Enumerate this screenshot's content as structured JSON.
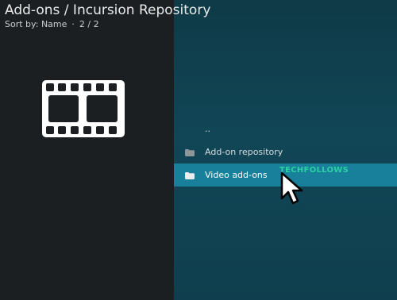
{
  "header": {
    "title": "Add-ons / Incursion Repository",
    "sort_label": "Sort by: Name",
    "separator": "·",
    "page_indicator": "2 / 2"
  },
  "thumbnail": {
    "icon": "film-strip-icon"
  },
  "list": {
    "items": [
      {
        "label": "..",
        "icon": ""
      },
      {
        "label": "Add-on repository",
        "icon": "folder-icon"
      },
      {
        "label": "Video add-ons",
        "icon": "folder-icon",
        "selected": true
      }
    ]
  },
  "watermark": "TECHFOLLOWS",
  "colors": {
    "left_pane": "#1c1f22",
    "right_pane": "#114656",
    "selected_row": "#18809a",
    "watermark": "#2ad1a3"
  }
}
